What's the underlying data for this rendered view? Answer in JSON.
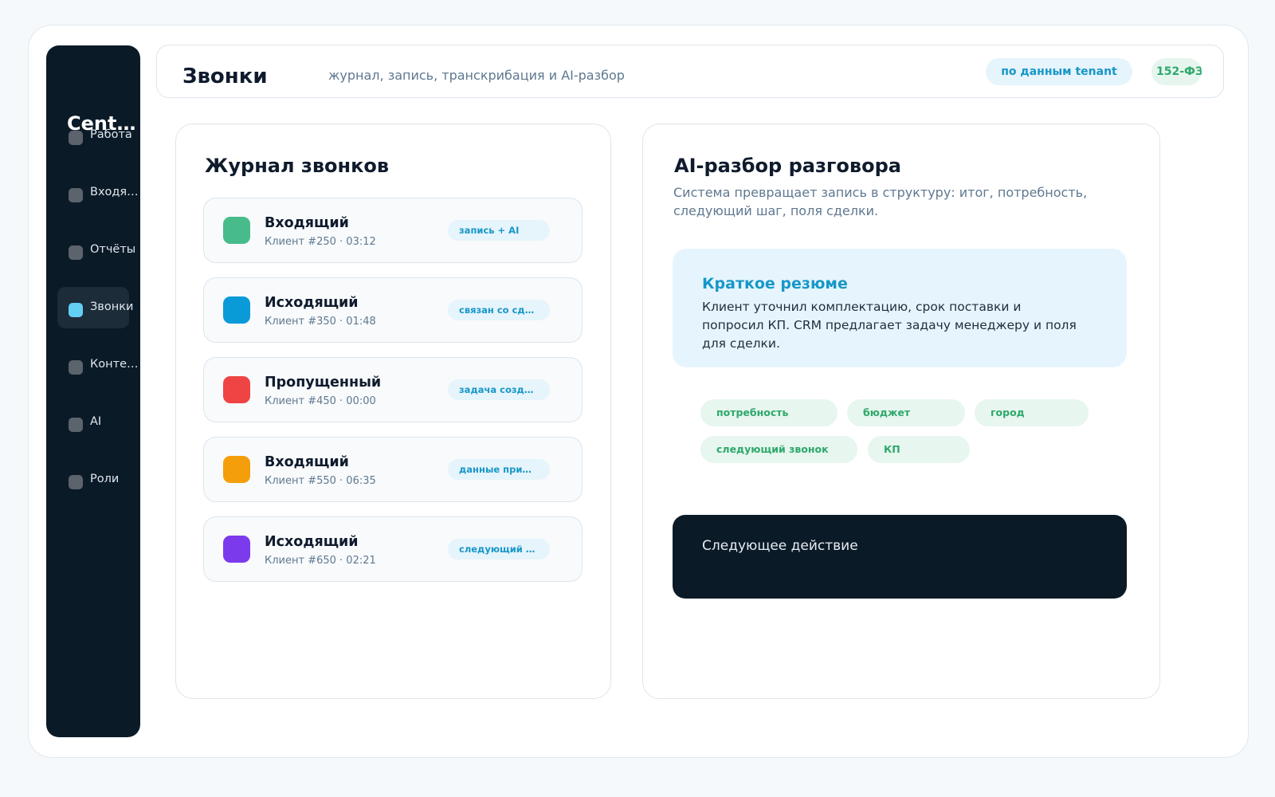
{
  "sidebar": {
    "brand": "Centra",
    "items": [
      {
        "label": "Работа",
        "active": false
      },
      {
        "label": "Входящие",
        "active": false
      },
      {
        "label": "Отчёты",
        "active": false
      },
      {
        "label": "Звонки",
        "active": true
      },
      {
        "label": "Контент",
        "active": false
      },
      {
        "label": "AI",
        "active": false
      },
      {
        "label": "Роли",
        "active": false
      }
    ]
  },
  "header": {
    "title": "Звонки",
    "subtitle": "журнал, запись, транскрибация и AI-разбор",
    "badge_tenant": "по данным tenant",
    "badge_count": "152-ФЗ"
  },
  "call_log": {
    "title": "Журнал звонков",
    "calls": [
      {
        "type": "Входящий",
        "meta": "Клиент #250 · 03:12",
        "tag": "запись + AI",
        "color": "#48bb8a"
      },
      {
        "type": "Исходящий",
        "meta": "Клиент #350 · 01:48",
        "tag": "связан со сделкой",
        "color": "#0b9ad8"
      },
      {
        "type": "Пропущенный",
        "meta": "Клиент #450 · 00:00",
        "tag": "задача создана",
        "color": "#ef4444"
      },
      {
        "type": "Входящий",
        "meta": "Клиент #550 · 06:35",
        "tag": "данные применены",
        "color": "#f59e0b"
      },
      {
        "type": "Исходящий",
        "meta": "Клиент #650 · 02:21",
        "tag": "следующий шаг",
        "color": "#7c3aed"
      }
    ]
  },
  "ai_analysis": {
    "title": "AI-разбор разговора",
    "subtitle": "Система превращает запись в структуру: итог, потребность, следующий шаг, поля сделки.",
    "summary": {
      "title": "Краткое резюме",
      "text": "Клиент уточнил комплектацию, срок поставки и попросил КП. CRM предлагает задачу менеджеру и поля для сделки."
    },
    "chips": [
      "потребность",
      "бюджет",
      "город",
      "следующий звонок",
      "КП"
    ],
    "next_action_label": "Следующее действие"
  },
  "colors": {
    "accent": "#1797c8",
    "sidebar_bg": "#0b1a27",
    "chip_green": "#2ea86c",
    "active_dot": "#63cff3"
  }
}
